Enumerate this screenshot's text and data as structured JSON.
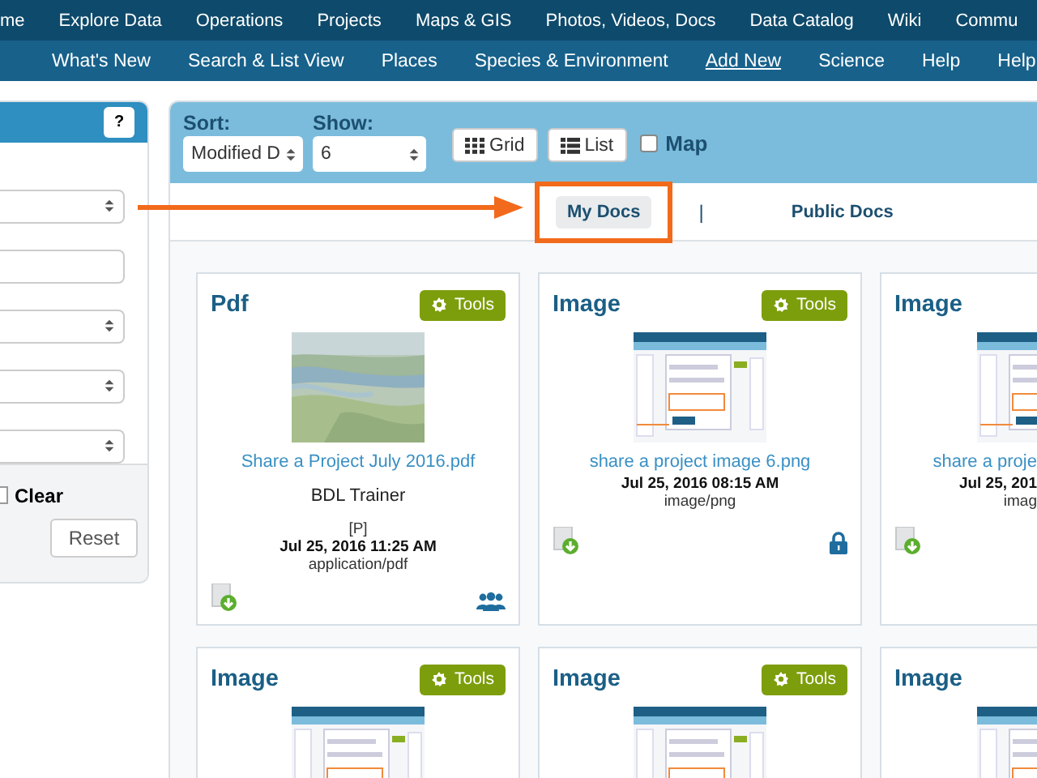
{
  "top_nav": [
    {
      "label": "me"
    },
    {
      "label": "Explore Data"
    },
    {
      "label": "Operations"
    },
    {
      "label": "Projects"
    },
    {
      "label": "Maps & GIS"
    },
    {
      "label": "Photos, Videos, Docs"
    },
    {
      "label": "Data Catalog"
    },
    {
      "label": "Wiki"
    },
    {
      "label": "Commu"
    }
  ],
  "sub_nav": [
    {
      "label": "What's New",
      "selected": false
    },
    {
      "label": "Search & List View",
      "selected": false
    },
    {
      "label": "Places",
      "selected": false
    },
    {
      "label": "Species & Environment",
      "selected": false
    },
    {
      "label": "Add New",
      "selected": true
    },
    {
      "label": "Science",
      "selected": false
    },
    {
      "label": "Help",
      "selected": false
    },
    {
      "label": "Help",
      "selected": false
    }
  ],
  "filter_panel": {
    "help": "?",
    "fields": [
      {
        "kind": "select"
      },
      {
        "kind": "input"
      },
      {
        "kind": "select"
      },
      {
        "kind": "select"
      },
      {
        "kind": "select"
      }
    ],
    "clear_checked": false,
    "clear_label": "Clear",
    "reset": "Reset"
  },
  "toolbar": {
    "sort_label": "Sort:",
    "sort_value": "Modified D",
    "show_label": "Show:",
    "show_value": "6",
    "view_buttons": [
      {
        "label": "Grid"
      },
      {
        "label": "List"
      }
    ],
    "map": {
      "label": "Map",
      "checked": false
    }
  },
  "doc_tabs": [
    {
      "label": "My Docs",
      "selected": true,
      "highlighted": true
    },
    {
      "label": "Public Docs",
      "selected": false,
      "highlighted": false
    }
  ],
  "tab_separator": "|",
  "cards": [
    {
      "kind": "shared",
      "title": "Pdf",
      "tools": "Tools",
      "link": "Share a Project July 2016.pdf",
      "owner": "BDL Trainer",
      "flag": "[P]",
      "date": "Jul 25, 2016 11:25 AM",
      "mime": "application/pdf"
    },
    {
      "kind": "private",
      "title": "Image",
      "tools": "Tools",
      "link": "share a project image 6.png",
      "date": "Jul 25, 2016 08:15 AM",
      "mime": "image/png"
    },
    {
      "kind": "plain",
      "title": "Image",
      "link": "share a proje",
      "date": "Jul 25, 201",
      "mime": "imag"
    },
    {
      "title": "Image",
      "tools": "Tools"
    },
    {
      "title": "Image",
      "tools": "Tools"
    },
    {
      "title": "Image"
    }
  ]
}
